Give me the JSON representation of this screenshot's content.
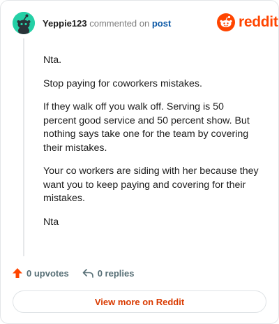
{
  "header": {
    "username": "Yeppie123",
    "commented_text": "commented on",
    "post_link": "post"
  },
  "brand": {
    "wordmark": "reddit",
    "accent_color": "#ff4500",
    "logo_icon": "reddit-snoo-icon"
  },
  "avatar": {
    "icon": "snoo-avatar-icon",
    "background_color": "#25d0a6"
  },
  "comment": {
    "paragraphs": [
      "Nta.",
      "Stop paying for coworkers mistakes.",
      "If they walk off you walk off. Serving is 50 percent good service and 50 percent show. But nothing says take one for the team by covering their mistakes.",
      "Your co workers are siding with her because they want you to keep paying and covering for their mistakes.",
      "Nta"
    ]
  },
  "actions": {
    "upvotes_label": "0 upvotes",
    "upvote_icon": "upvote-arrow-icon",
    "upvote_color": "#ff4500",
    "replies_label": "0 replies",
    "reply_icon": "reply-arrow-icon"
  },
  "view_more": {
    "label": "View more on Reddit",
    "color": "#d93a00"
  }
}
